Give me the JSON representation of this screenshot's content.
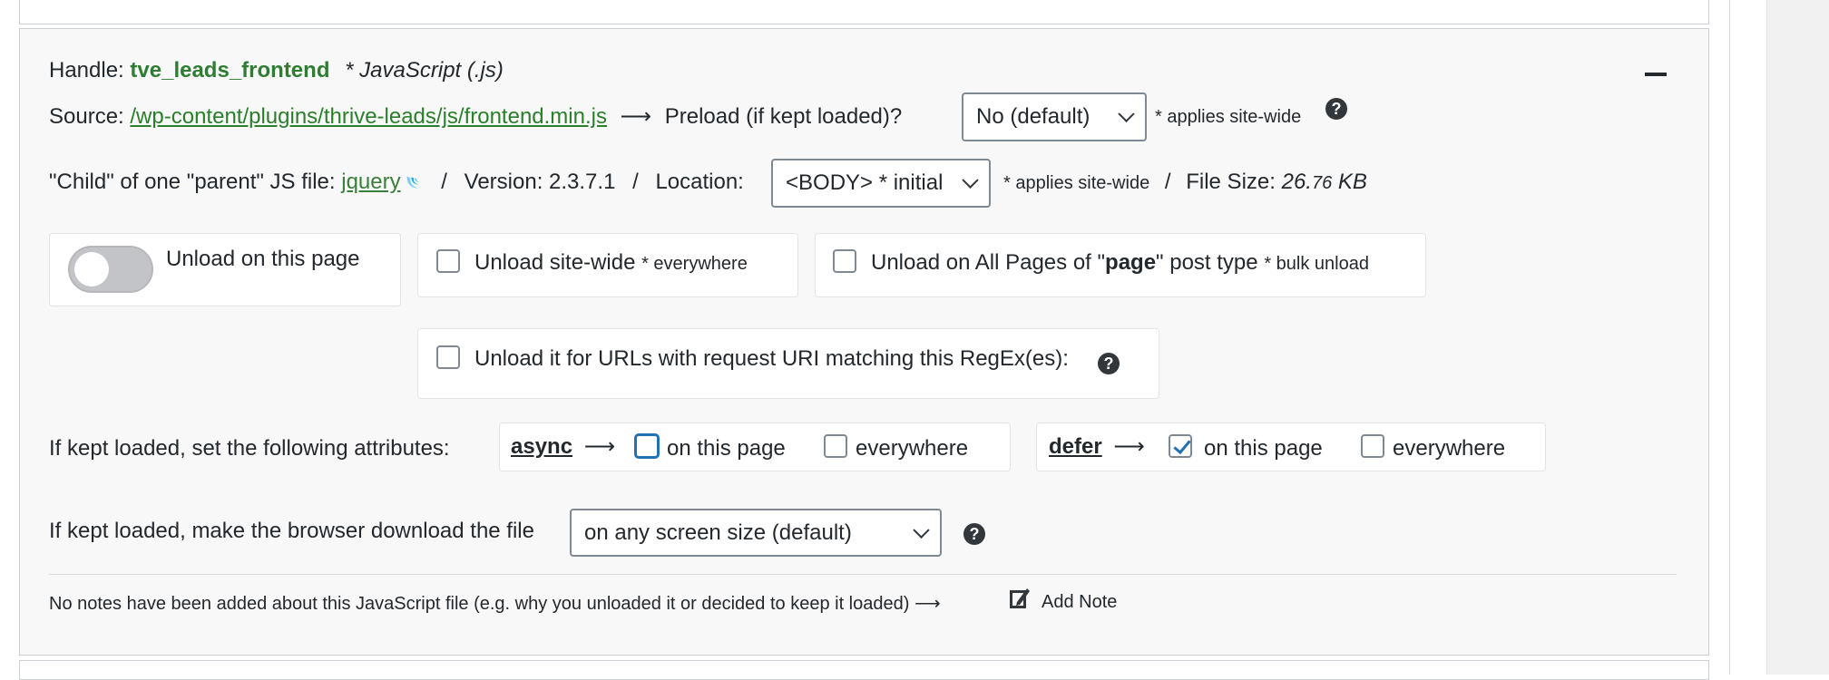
{
  "handle": {
    "label": "Handle:",
    "name": "tve_leads_frontend",
    "type": "* JavaScript (.js)"
  },
  "source": {
    "label": "Source:",
    "path": "/wp-content/plugins/thrive-leads/js/frontend.min.js",
    "arrow": "⟶",
    "preload_label": "Preload (if kept loaded)?",
    "preload_value": "No (default)",
    "preload_note": "* applies site-wide"
  },
  "meta": {
    "child_of_label": "\"Child\" of one \"parent\" JS file:",
    "parent_link": "jquery",
    "sep": "/",
    "version_label": "Version: 2.3.7.1",
    "location_label": "Location:",
    "location_value": "<BODY> * initial",
    "location_note": "* applies site-wide",
    "file_size_label": "File Size:",
    "file_size_main": "26.",
    "file_size_decimals": "76",
    "file_size_unit": "KB"
  },
  "unload": {
    "on_page_label": "Unload on this page",
    "on_page_enabled": false,
    "site_wide_label": "Unload site-wide",
    "site_wide_note": "* everywhere",
    "post_type_prefix": "Unload on All Pages of \"",
    "post_type_name": "page",
    "post_type_suffix": "\" post type",
    "post_type_note": "* bulk unload",
    "regex_label": "Unload it for URLs with request URI matching this RegEx(es):"
  },
  "attributes": {
    "intro": "If kept loaded, set the following attributes:",
    "arrow": "⟶",
    "async_label": "async",
    "async_on_page": "on this page",
    "async_on_page_checked": false,
    "async_everywhere": "everywhere",
    "async_everywhere_checked": false,
    "defer_label": "defer",
    "defer_on_page": "on this page",
    "defer_on_page_checked": true,
    "defer_everywhere": "everywhere",
    "defer_everywhere_checked": false
  },
  "download": {
    "label": "If kept loaded, make the browser download the file",
    "value": "on any screen size (default)"
  },
  "notes": {
    "text": "No notes have been added about this JavaScript file (e.g. why you unloaded it or decided to keep it loaded) ⟶",
    "add_label": "Add Note"
  },
  "help_glyph": "?",
  "icons": [
    "collapse-icon",
    "help-icon",
    "jquery-icon",
    "chevron-down-icon",
    "note-icon"
  ],
  "colors": {
    "handle_green": "#2e7d32",
    "link_green": "#2a7f2a",
    "checkbox_blue": "#2271b1",
    "card_bg": "#f8f8f8"
  }
}
